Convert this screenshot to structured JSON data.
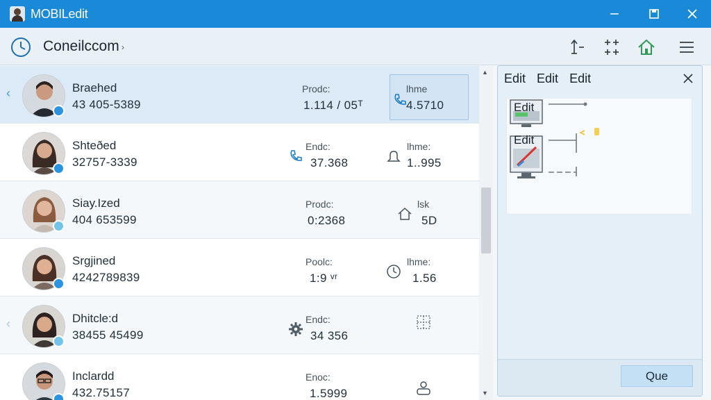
{
  "window": {
    "title": "MOBILedit",
    "accent": "#1a8ad8"
  },
  "toolbar": {
    "breadcrumb": "Coneilccom",
    "breadcrumb_arrow": "›",
    "icons": [
      "clock-icon",
      "sort-icon",
      "grid-plus-icon",
      "home-icon",
      "menu-icon"
    ]
  },
  "contacts": [
    {
      "name": "Braehed",
      "phone": "43 405-5389",
      "col1_label": "Prodc:",
      "col1_value": "1.114 / 05ᵀ",
      "col2_label": "lhme",
      "col2_value": "4.5710",
      "col1_icon": "none",
      "col2_icon": "phone-icon",
      "selected": true
    },
    {
      "name": "Shteðed",
      "phone": "32757-3339",
      "col1_label": "Endc:",
      "col1_value": "37.368",
      "col2_label": "lhme:",
      "col2_value": "1..995",
      "col1_icon": "phone-icon",
      "col2_icon": "bell-icon"
    },
    {
      "name": "Siay.Ized",
      "phone": "404 653599",
      "col1_label": "Prodc:",
      "col1_value": "0:2368",
      "col2_label": "lsk",
      "col2_value": "5D",
      "col1_icon": "none",
      "col2_icon": "house-icon"
    },
    {
      "name": "Srgjined",
      "phone": "4242789839",
      "col1_label": "Poolc:",
      "col1_value": "1:9 ᵛʳ",
      "col2_label": "lhme:",
      "col2_value": "1.56",
      "col1_icon": "none",
      "col2_icon": "clock-icon"
    },
    {
      "name": "Dhitcle:d",
      "phone": "38455 45499",
      "col1_label": "Endc:",
      "col1_value": "34 356",
      "col2_label": "",
      "col2_value": "",
      "col1_icon": "gear-icon",
      "col2_icon": "grid-icon"
    },
    {
      "name": "Inclardd",
      "phone": "432.75157",
      "col1_label": "Enoc:",
      "col1_value": "1.5999",
      "col2_label": "",
      "col2_value": "",
      "col1_icon": "none",
      "col2_icon": "people-icon"
    }
  ],
  "panel": {
    "tabs": [
      "Edit",
      "Edit",
      "Edit"
    ],
    "nodes": [
      "Edit",
      "Edit"
    ],
    "ok_label": "Que"
  }
}
